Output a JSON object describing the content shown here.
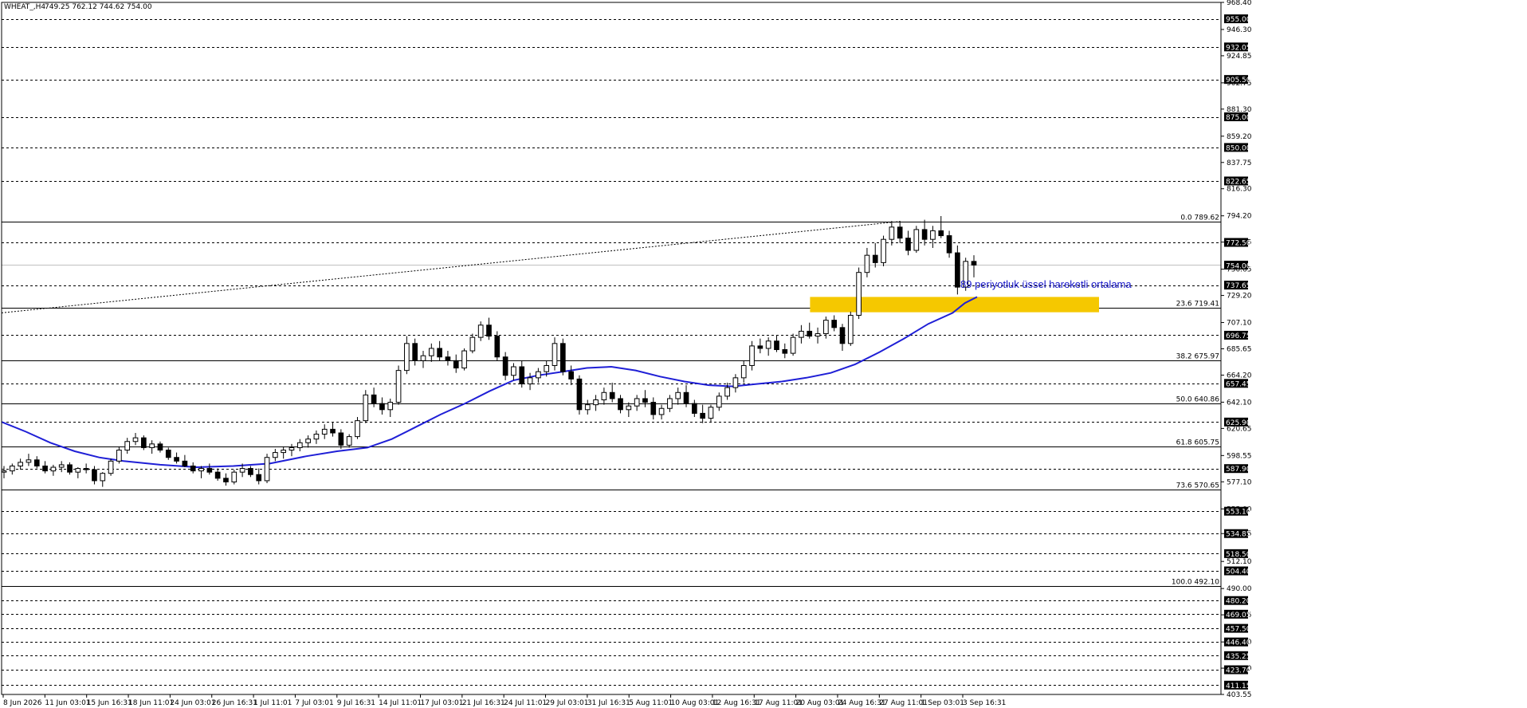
{
  "header": {
    "symbol_label": "WHEAT_,H4",
    "ohlc_label": "749.25 762.12 744.62 754.00"
  },
  "colors": {
    "background": "#ffffff",
    "candle": "#000000",
    "ema": "#1f1fd6",
    "zone": "#f5c800",
    "annotation": "#1414c8",
    "grid_dash": "#000000",
    "current_price_line": "#c0c0c0"
  },
  "annotation": {
    "text": "89 periyotluk üssel hareketli ortalama"
  },
  "chart_data": {
    "type": "candlestick",
    "y_min": 403.55,
    "y_max": 968.4,
    "y_ticks": [
      "968.40",
      "946.30",
      "924.85",
      "902.75",
      "881.30",
      "859.20",
      "837.75",
      "816.30",
      "794.20",
      "772.75",
      "750.65",
      "729.20",
      "707.10",
      "685.65",
      "664.20",
      "642.10",
      "620.65",
      "598.55",
      "577.10",
      "555.00",
      "534.85",
      "512.10",
      "490.00",
      "468.55",
      "446.40",
      "425.00",
      "403.55"
    ],
    "x_labels": [
      "8 Jun 2026",
      "11 Jun 03:01",
      "15 Jun 16:31",
      "18 Jun 11:01",
      "24 Jun 03:01",
      "26 Jun 16:31",
      "1 Jul 11:01",
      "7 Jul 03:01",
      "9 Jul 16:31",
      "14 Jul 11:01",
      "17 Jul 03:01",
      "21 Jul 16:31",
      "24 Jul 11:01",
      "29 Jul 03:01",
      "31 Jul 16:31",
      "5 Aug 11:01",
      "10 Aug 03:01",
      "12 Aug 16:31",
      "17 Aug 11:01",
      "20 Aug 03:01",
      "24 Aug 16:31",
      "27 Aug 11:01",
      "1 Sep 03:01",
      "3 Sep 16:31"
    ],
    "horizontal_levels": [
      {
        "price": 955.0,
        "label": "955.00"
      },
      {
        "price": 932.05,
        "label": "932.05"
      },
      {
        "price": 905.5,
        "label": "905.50"
      },
      {
        "price": 875.0,
        "label": "875.00"
      },
      {
        "price": 850.0,
        "label": "850.00"
      },
      {
        "price": 822.65,
        "label": "822.65"
      },
      {
        "price": 772.5,
        "label": "772.50"
      },
      {
        "price": 737.65,
        "label": "737.65"
      },
      {
        "price": 696.75,
        "label": "696.75"
      },
      {
        "price": 657.45,
        "label": "657.45"
      },
      {
        "price": 625.9,
        "label": "625.90"
      },
      {
        "price": 587.9,
        "label": "587.90"
      },
      {
        "price": 553.1,
        "label": "553.10"
      },
      {
        "price": 534.85,
        "label": "534.85"
      },
      {
        "price": 518.5,
        "label": "518.50"
      },
      {
        "price": 504.4,
        "label": "504.40"
      },
      {
        "price": 480.2,
        "label": "480.20"
      },
      {
        "price": 469.05,
        "label": "469.05"
      },
      {
        "price": 457.5,
        "label": "457.50"
      },
      {
        "price": 446.4,
        "label": "446.40"
      },
      {
        "price": 435.25,
        "label": "435.25"
      },
      {
        "price": 423.7,
        "label": "423.70"
      },
      {
        "price": 411.15,
        "label": "411.15"
      }
    ],
    "current_price": {
      "price": 754.0,
      "label": "754.00"
    },
    "fibonacci": [
      {
        "price": 789.62,
        "label": "0.0 789.62"
      },
      {
        "price": 719.41,
        "label": "23.6 719.41"
      },
      {
        "price": 675.97,
        "label": "38.2 675.97"
      },
      {
        "price": 640.86,
        "label": "50.0 640.86"
      },
      {
        "price": 605.75,
        "label": "61.8 605.75"
      },
      {
        "price": 570.65,
        "label": "73.6 570.65"
      },
      {
        "price": 492.1,
        "label": "100.0 492.10"
      }
    ],
    "zone": {
      "x_start": 0.663,
      "x_end": 0.9,
      "price_low": 715.5,
      "price_high": 728.0
    },
    "trendline": {
      "x_start": 0.0,
      "price_start": 715.0,
      "x_end": 0.737,
      "price_end": 789.62
    },
    "ema_89": [
      [
        0.0,
        626
      ],
      [
        0.02,
        618
      ],
      [
        0.04,
        609
      ],
      [
        0.06,
        602
      ],
      [
        0.08,
        597
      ],
      [
        0.1,
        594
      ],
      [
        0.13,
        591
      ],
      [
        0.16,
        589
      ],
      [
        0.19,
        590
      ],
      [
        0.22,
        592
      ],
      [
        0.25,
        598
      ],
      [
        0.275,
        602
      ],
      [
        0.3,
        605
      ],
      [
        0.32,
        612
      ],
      [
        0.34,
        622
      ],
      [
        0.36,
        632
      ],
      [
        0.38,
        641
      ],
      [
        0.4,
        651
      ],
      [
        0.42,
        660
      ],
      [
        0.44,
        664
      ],
      [
        0.46,
        667
      ],
      [
        0.48,
        670
      ],
      [
        0.5,
        671
      ],
      [
        0.52,
        668
      ],
      [
        0.54,
        663
      ],
      [
        0.56,
        659
      ],
      [
        0.58,
        656
      ],
      [
        0.6,
        655
      ],
      [
        0.62,
        657
      ],
      [
        0.64,
        659
      ],
      [
        0.66,
        662
      ],
      [
        0.68,
        666
      ],
      [
        0.7,
        673
      ],
      [
        0.72,
        683
      ],
      [
        0.74,
        694
      ],
      [
        0.76,
        706
      ],
      [
        0.78,
        715
      ],
      [
        0.79,
        723
      ],
      [
        0.8,
        728
      ]
    ],
    "ohlc": [
      [
        585,
        590,
        580,
        586
      ],
      [
        586,
        592,
        583,
        590
      ],
      [
        590,
        596,
        587,
        593
      ],
      [
        593,
        600,
        590,
        595
      ],
      [
        595,
        598,
        588,
        590
      ],
      [
        590,
        594,
        584,
        586
      ],
      [
        586,
        591,
        582,
        589
      ],
      [
        589,
        594,
        585,
        591
      ],
      [
        591,
        593,
        583,
        585
      ],
      [
        585,
        589,
        580,
        588
      ],
      [
        588,
        592,
        584,
        587
      ],
      [
        587,
        590,
        575,
        578
      ],
      [
        578,
        585,
        573,
        584
      ],
      [
        584,
        596,
        582,
        594
      ],
      [
        594,
        606,
        592,
        603
      ],
      [
        603,
        613,
        600,
        610
      ],
      [
        610,
        617,
        607,
        613
      ],
      [
        613,
        615,
        603,
        605
      ],
      [
        605,
        611,
        600,
        608
      ],
      [
        608,
        610,
        601,
        603
      ],
      [
        603,
        605,
        595,
        597
      ],
      [
        597,
        601,
        592,
        594
      ],
      [
        594,
        599,
        589,
        590
      ],
      [
        590,
        593,
        584,
        586
      ],
      [
        586,
        590,
        580,
        588
      ],
      [
        588,
        592,
        583,
        585
      ],
      [
        585,
        588,
        578,
        580
      ],
      [
        580,
        584,
        574,
        577
      ],
      [
        577,
        587,
        575,
        585
      ],
      [
        585,
        592,
        581,
        588
      ],
      [
        588,
        590,
        581,
        583
      ],
      [
        583,
        588,
        575,
        578
      ],
      [
        578,
        600,
        576,
        597
      ],
      [
        597,
        604,
        594,
        601
      ],
      [
        601,
        606,
        596,
        603
      ],
      [
        603,
        608,
        598,
        605
      ],
      [
        605,
        612,
        602,
        609
      ],
      [
        609,
        615,
        605,
        612
      ],
      [
        612,
        619,
        608,
        616
      ],
      [
        616,
        624,
        612,
        620
      ],
      [
        620,
        626,
        614,
        617
      ],
      [
        617,
        620,
        604,
        607
      ],
      [
        607,
        616,
        605,
        614
      ],
      [
        614,
        630,
        612,
        627
      ],
      [
        627,
        652,
        625,
        648
      ],
      [
        648,
        654,
        638,
        641
      ],
      [
        641,
        646,
        632,
        636
      ],
      [
        636,
        645,
        630,
        642
      ],
      [
        642,
        672,
        640,
        668
      ],
      [
        668,
        696,
        665,
        690
      ],
      [
        690,
        694,
        672,
        676
      ],
      [
        676,
        684,
        670,
        680
      ],
      [
        680,
        690,
        675,
        686
      ],
      [
        686,
        692,
        676,
        679
      ],
      [
        679,
        684,
        672,
        676
      ],
      [
        676,
        681,
        666,
        670
      ],
      [
        670,
        686,
        668,
        684
      ],
      [
        684,
        698,
        682,
        695
      ],
      [
        695,
        708,
        692,
        705
      ],
      [
        705,
        711,
        693,
        696
      ],
      [
        696,
        700,
        676,
        679
      ],
      [
        679,
        683,
        660,
        664
      ],
      [
        664,
        674,
        660,
        671
      ],
      [
        671,
        676,
        654,
        657
      ],
      [
        657,
        666,
        652,
        662
      ],
      [
        662,
        670,
        658,
        667
      ],
      [
        667,
        676,
        663,
        672
      ],
      [
        672,
        695,
        668,
        690
      ],
      [
        690,
        694,
        664,
        667
      ],
      [
        667,
        672,
        656,
        661
      ],
      [
        661,
        664,
        632,
        636
      ],
      [
        636,
        644,
        632,
        640
      ],
      [
        640,
        648,
        635,
        644
      ],
      [
        644,
        654,
        640,
        650
      ],
      [
        650,
        658,
        642,
        645
      ],
      [
        645,
        648,
        633,
        636
      ],
      [
        636,
        642,
        630,
        639
      ],
      [
        639,
        648,
        635,
        645
      ],
      [
        645,
        652,
        638,
        642
      ],
      [
        642,
        646,
        628,
        632
      ],
      [
        632,
        640,
        628,
        637
      ],
      [
        637,
        648,
        634,
        645
      ],
      [
        645,
        654,
        640,
        650
      ],
      [
        650,
        656,
        638,
        641
      ],
      [
        641,
        644,
        630,
        633
      ],
      [
        633,
        640,
        625,
        629
      ],
      [
        629,
        640,
        626,
        638
      ],
      [
        638,
        650,
        635,
        647
      ],
      [
        647,
        658,
        644,
        654
      ],
      [
        654,
        665,
        650,
        662
      ],
      [
        662,
        676,
        658,
        672
      ],
      [
        672,
        692,
        668,
        688
      ],
      [
        688,
        694,
        682,
        686
      ],
      [
        686,
        695,
        680,
        692
      ],
      [
        692,
        697,
        683,
        685
      ],
      [
        685,
        690,
        678,
        682
      ],
      [
        682,
        698,
        680,
        695
      ],
      [
        695,
        705,
        690,
        700
      ],
      [
        700,
        707,
        694,
        696
      ],
      [
        696,
        703,
        690,
        698
      ],
      [
        698,
        712,
        694,
        709
      ],
      [
        709,
        713,
        700,
        703
      ],
      [
        703,
        706,
        684,
        690
      ],
      [
        690,
        716,
        688,
        713
      ],
      [
        713,
        752,
        710,
        748
      ],
      [
        748,
        768,
        744,
        762
      ],
      [
        762,
        772,
        752,
        756
      ],
      [
        756,
        778,
        753,
        775
      ],
      [
        775,
        790,
        770,
        785
      ],
      [
        785,
        790,
        772,
        776
      ],
      [
        776,
        782,
        762,
        766
      ],
      [
        766,
        786,
        764,
        783
      ],
      [
        783,
        791,
        770,
        775
      ],
      [
        775,
        786,
        768,
        782
      ],
      [
        782,
        794,
        776,
        778
      ],
      [
        778,
        782,
        760,
        764
      ],
      [
        764,
        770,
        730,
        736
      ],
      [
        736,
        760,
        733,
        757
      ],
      [
        757,
        762,
        744,
        754
      ]
    ]
  }
}
